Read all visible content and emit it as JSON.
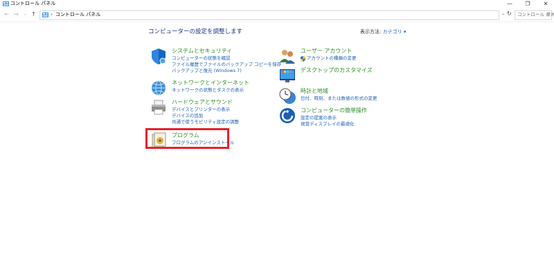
{
  "window": {
    "title": "コントロール パネル",
    "minimize_icon": "—",
    "restore_icon": "❐",
    "close_icon": "✕"
  },
  "address_bar": {
    "back_icon": "←",
    "forward_icon": "→",
    "history_icon": "⌄",
    "up_icon": "↑",
    "breadcrumb_separator": "›",
    "breadcrumb": "コントロール パネル",
    "dropdown_icon": "⌄",
    "refresh_icon": "↻",
    "search_placeholder": "コントロール パネ",
    "search_icon": "⚲"
  },
  "main": {
    "heading": "コンピューターの設定を調整します",
    "view_by_label": "表示方法:",
    "view_by_value": "カテゴリ ▾"
  },
  "left_categories": [
    {
      "icon": "shield-icon",
      "title": "システムとセキュリティ",
      "links": [
        "コンピューターの状態を確認",
        "ファイル履歴でファイルのバックアップ コピーを保存",
        "バックアップと復元 (Windows 7)"
      ]
    },
    {
      "icon": "network-globe-icon",
      "title": "ネットワークとインターネット",
      "links": [
        "ネットワークの状態とタスクの表示"
      ]
    },
    {
      "icon": "printer-icon",
      "title": "ハードウェアとサウンド",
      "links": [
        "デバイスとプリンターの表示",
        "デバイスの追加",
        "共通で使うモビリティ設定の調整"
      ]
    },
    {
      "icon": "programs-icon",
      "title": "プログラム",
      "links": [
        "プログラムのアンインストール"
      ]
    }
  ],
  "right_categories": [
    {
      "icon": "users-icon",
      "title": "ユーザー アカウント",
      "links": [
        "アカウントの種類の変更"
      ]
    },
    {
      "icon": "appearance-icon",
      "title": "デスクトップのカスタマイズ",
      "links": []
    },
    {
      "icon": "clock-globe-icon",
      "title": "時計と地域",
      "links": [
        "日付、時刻、または数値の形式の変更"
      ]
    },
    {
      "icon": "ease-of-access-icon",
      "title": "コンピューターの簡単操作",
      "links": [
        "設定の提案の表示",
        "視覚ディスプレイの最適化"
      ]
    }
  ],
  "colors": {
    "category_title": "#2c8c28",
    "link": "#1a5fb4",
    "heading": "#1e3287",
    "highlight_border": "#e8202a"
  }
}
